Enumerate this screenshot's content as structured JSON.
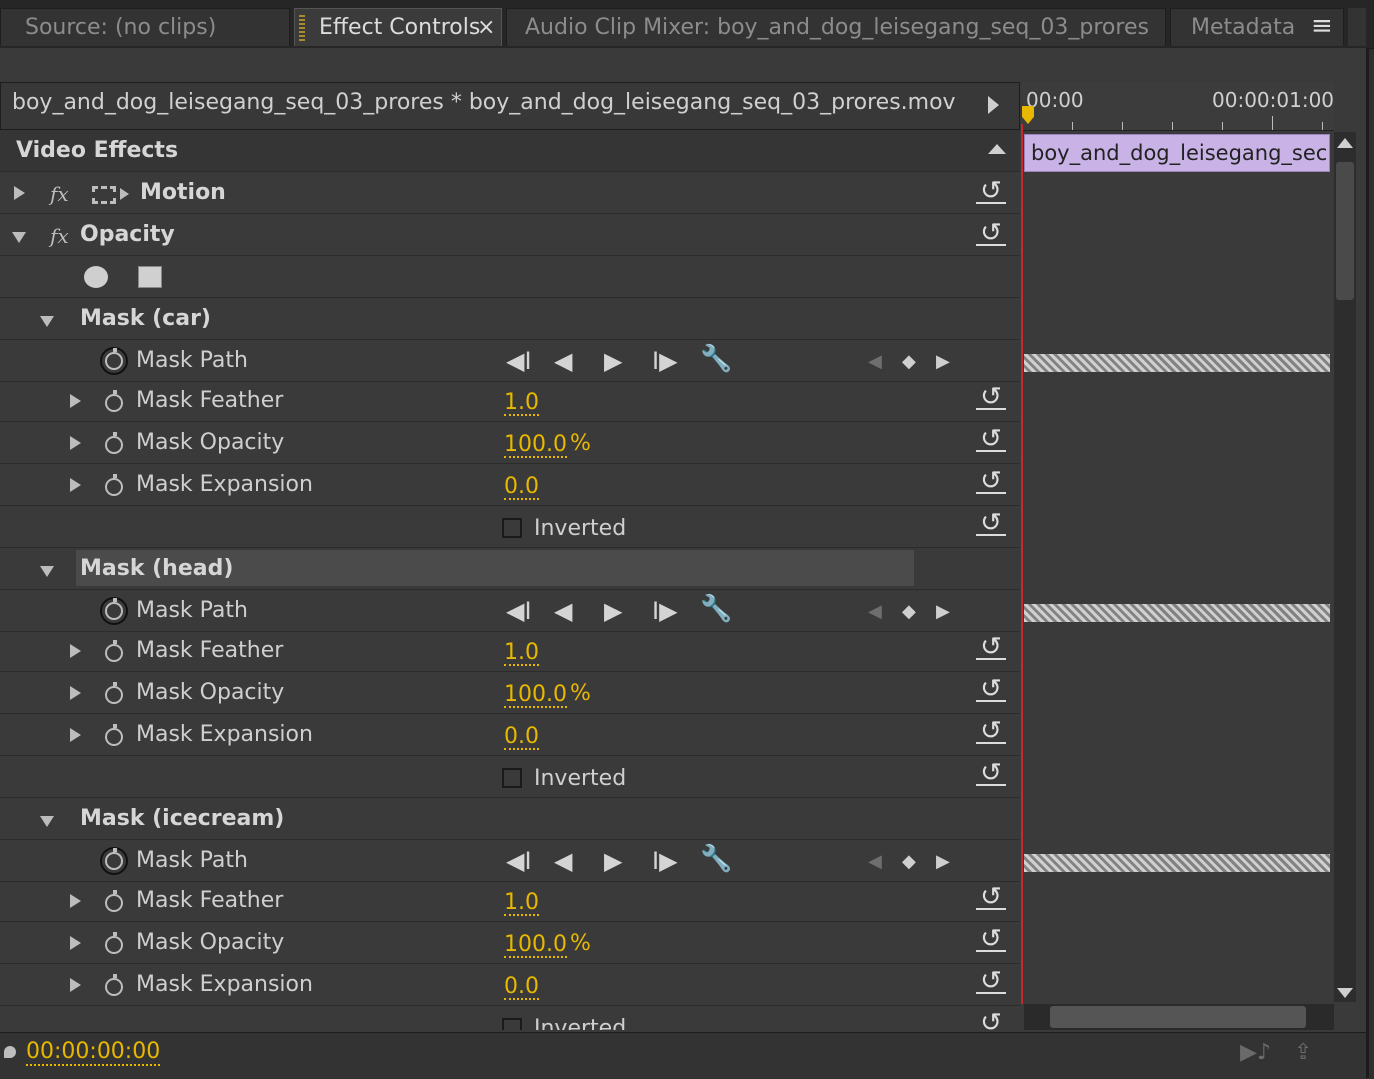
{
  "tabs": [
    {
      "label": "Source: (no clips)",
      "active": false
    },
    {
      "label": "Effect Controls",
      "active": true
    },
    {
      "label": "Audio Clip Mixer: boy_and_dog_leisegang_seq_03_prores",
      "active": false
    },
    {
      "label": "Metadata",
      "active": false
    }
  ],
  "tab_close": "×",
  "panel_menu_icon": "≡",
  "header": {
    "clip_title": "boy_and_dog_leisegang_seq_03_prores * boy_and_dog_leisegang_seq_03_prores.mov"
  },
  "timeline": {
    "start_label": "00:00",
    "end_label": "00:00:01:00",
    "clip_name": "boy_and_dog_leisegang_sec"
  },
  "section_title": "Video Effects",
  "effects": {
    "motion": "Motion",
    "opacity": "Opacity",
    "fx": "fx"
  },
  "masks": [
    {
      "name": "Mask (car)",
      "path": "Mask Path",
      "feather_label": "Mask Feather",
      "feather": "1.0",
      "opacity_label": "Mask Opacity",
      "opacity": "100.0",
      "expansion_label": "Mask Expansion",
      "expansion": "0.0",
      "inverted": "Inverted"
    },
    {
      "name": "Mask (head)",
      "path": "Mask Path",
      "feather_label": "Mask Feather",
      "feather": "1.0",
      "opacity_label": "Mask Opacity",
      "opacity": "100.0",
      "expansion_label": "Mask Expansion",
      "expansion": "0.0",
      "inverted": "Inverted"
    },
    {
      "name": "Mask (icecream)",
      "path": "Mask Path",
      "feather_label": "Mask Feather",
      "feather": "1.0",
      "opacity_label": "Mask Opacity",
      "opacity": "100.0",
      "expansion_label": "Mask Expansion",
      "expansion": "0.0",
      "inverted": "Inverted"
    }
  ],
  "percent": "%",
  "footer": {
    "timecode": "00:00:00:00"
  },
  "colors": {
    "accent": "#e8b800",
    "clip": "#c9b3e6",
    "playhead": "#c8282c"
  }
}
